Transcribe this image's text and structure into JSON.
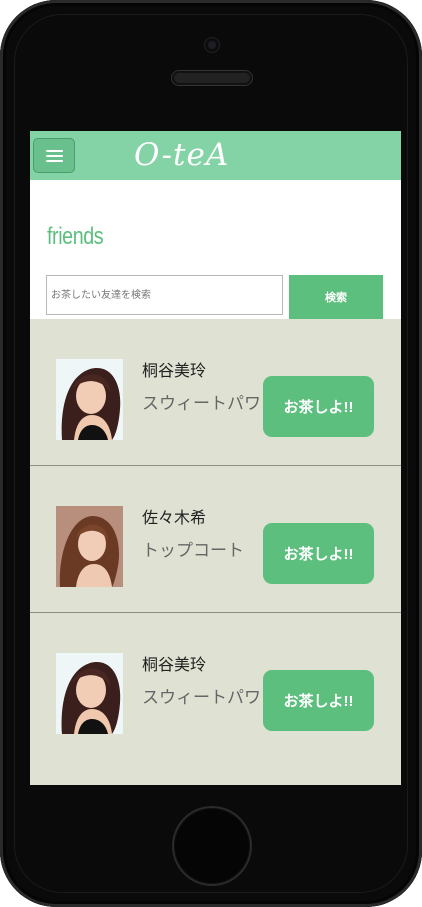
{
  "navbar": {
    "brand": "O-teA",
    "menu_icon": "hamburger-menu-icon"
  },
  "page": {
    "title": "friends"
  },
  "search": {
    "placeholder": "お茶したい友達を検索",
    "button_label": "検索"
  },
  "friends": [
    {
      "name": "桐谷美玲",
      "description": "スウィートパワー",
      "action_label": "お茶しよ!!"
    },
    {
      "name": "佐々木希",
      "description": "トップコート",
      "action_label": "お茶しよ!!"
    },
    {
      "name": "桐谷美玲",
      "description": "スウィートパワー",
      "action_label": "お茶しよ!!"
    }
  ],
  "colors": {
    "accent": "#5cbf7e",
    "navbar": "#84d3a6",
    "list_background": "#dfe2d3",
    "device_frame": "#0a0a0a"
  }
}
